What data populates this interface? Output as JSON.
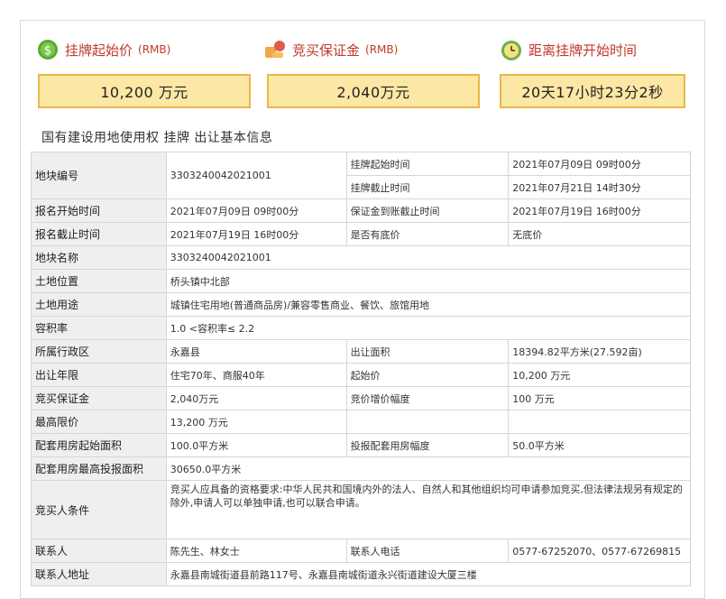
{
  "cards": [
    {
      "title": "挂牌起始价",
      "unit": "(RMB)",
      "value": "10,200 万元",
      "icon": "money-icon"
    },
    {
      "title": "竞买保证金",
      "unit": "(RMB)",
      "value": "2,040万元",
      "icon": "deposit-icon"
    },
    {
      "title": "距离挂牌开始时间",
      "unit": "",
      "value": "20天17小时23分2秒",
      "icon": "clock-icon"
    }
  ],
  "section_title": "国有建设用地使用权 挂牌 出让基本信息",
  "table": {
    "parcel_no_label": "地块编号",
    "parcel_no": "3303240042021001",
    "listing_start_label": "挂牌起始时间",
    "listing_start": "2021年07月09日 09时00分",
    "listing_end_label": "挂牌截止时间",
    "listing_end": "2021年07月21日 14时30分",
    "reg_start_label": "报名开始时间",
    "reg_start": "2021年07月09日 09时00分",
    "deposit_deadline_label": "保证金到账截止时间",
    "deposit_deadline": "2021年07月19日 16时00分",
    "reg_end_label": "报名截止时间",
    "reg_end": "2021年07月19日 16时00分",
    "reserve_label": "是否有底价",
    "reserve": "无底价",
    "parcel_name_label": "地块名称",
    "parcel_name": "3303240042021001",
    "location_label": "土地位置",
    "location": "桥头镇中北部",
    "usage_label": "土地用途",
    "usage": "城镇住宅用地(普通商品房)/兼容零售商业、餐饮、旅馆用地",
    "far_label": "容积率",
    "far": "1.0 <容积率≤ 2.2",
    "district_label": "所属行政区",
    "district": "永嘉县",
    "area_label": "出让面积",
    "area": "18394.82平方米(27.592亩)",
    "term_label": "出让年限",
    "term": "住宅70年、商服40年",
    "start_price_label": "起始价",
    "start_price": "10,200 万元",
    "deposit_label": "竞买保证金",
    "deposit": "2,040万元",
    "increment_label": "竞价增价幅度",
    "increment": "100 万元",
    "max_price_label": "最高限价",
    "max_price": "13,200 万元",
    "housing_start_label": "配套用房起始面积",
    "housing_start": "100.0平方米",
    "housing_step_label": "投报配套用房幅度",
    "housing_step": "50.0平方米",
    "housing_max_label": "配套用房最高投报面积",
    "housing_max": "30650.0平方米",
    "conditions_label": "竞买人条件",
    "conditions": "竞买人应具备的资格要求:中华人民共和国境内外的法人、自然人和其他组织均可申请参加竞买,但法律法规另有规定的除外,申请人可以单独申请,也可以联合申请。",
    "contact_label": "联系人",
    "contact": "陈先生、林女士",
    "phone_label": "联系人电话",
    "phone": "0577-67252070、0577-67269815",
    "address_label": "联系人地址",
    "address": "永嘉县南城街道县前路117号、永嘉县南城街道永兴街道建设大厦三楼"
  },
  "colors": {
    "accent": "#c0392b",
    "card_bg": "#fde7a4",
    "card_border": "#e8b84a",
    "label_bg": "#efefef"
  }
}
